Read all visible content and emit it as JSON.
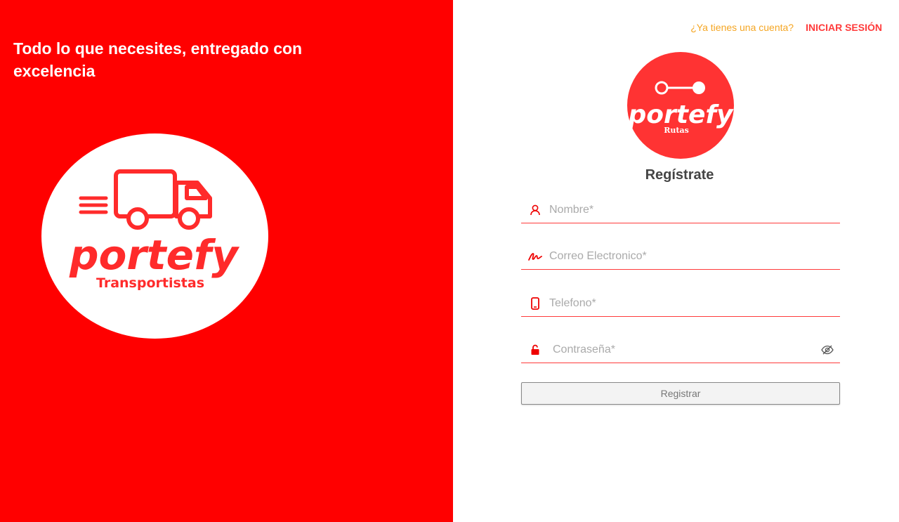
{
  "left_panel": {
    "tagline": "Todo lo que necesites, entregado con excelencia",
    "logo": {
      "wordmark": "portefy",
      "subtitle": "Transportistas"
    },
    "background_color": "#ff0000"
  },
  "header": {
    "have_account_text": "¿Ya tienes una cuenta?",
    "login_label": "INICIAR SESIÓN"
  },
  "form_logo": {
    "wordmark": "portefy",
    "subtitle": "Rutas"
  },
  "form": {
    "title": "Regístrate",
    "fields": [
      {
        "icon": "user-icon",
        "placeholder": "Nombre*",
        "value": ""
      },
      {
        "icon": "signature-icon",
        "placeholder": "Correo Electronico*",
        "value": ""
      },
      {
        "icon": "phone-icon",
        "placeholder": "Telefono*",
        "value": ""
      },
      {
        "icon": "unlock-icon",
        "placeholder": "Contraseña*",
        "value": ""
      }
    ],
    "password_toggle_icon": "eye-slash-icon",
    "submit_label": "Registrar"
  },
  "colors": {
    "accent": "#ff3b3b",
    "brand_red": "#ff0000",
    "question_text": "#f5a623"
  }
}
